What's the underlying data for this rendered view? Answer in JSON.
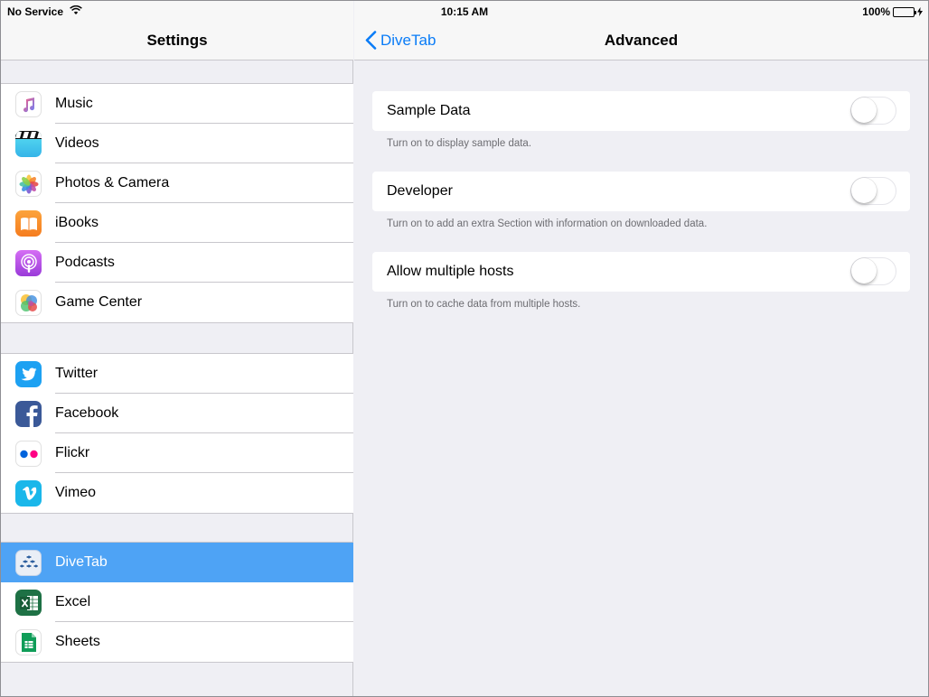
{
  "status": {
    "carrier": "No Service",
    "time": "10:15 AM",
    "battery": "100%",
    "battery_level": 1.0
  },
  "master": {
    "title": "Settings",
    "groups": [
      {
        "items": [
          {
            "label": "Music",
            "icon": "music-icon"
          },
          {
            "label": "Videos",
            "icon": "videos-icon"
          },
          {
            "label": "Photos & Camera",
            "icon": "photos-icon"
          },
          {
            "label": "iBooks",
            "icon": "ibooks-icon"
          },
          {
            "label": "Podcasts",
            "icon": "podcasts-icon"
          },
          {
            "label": "Game Center",
            "icon": "game-center-icon"
          }
        ]
      },
      {
        "items": [
          {
            "label": "Twitter",
            "icon": "twitter-icon"
          },
          {
            "label": "Facebook",
            "icon": "facebook-icon"
          },
          {
            "label": "Flickr",
            "icon": "flickr-icon"
          },
          {
            "label": "Vimeo",
            "icon": "vimeo-icon"
          }
        ]
      },
      {
        "items": [
          {
            "label": "DiveTab",
            "icon": "divetab-icon",
            "selected": true
          },
          {
            "label": "Excel",
            "icon": "excel-icon"
          },
          {
            "label": "Sheets",
            "icon": "sheets-icon"
          }
        ]
      }
    ]
  },
  "detail": {
    "back_label": "DiveTab",
    "title": "Advanced",
    "settings": [
      {
        "label": "Sample Data",
        "footer": "Turn on to display sample data.",
        "on": false
      },
      {
        "label": "Developer",
        "footer": "Turn on to add an extra Section with information on downloaded data.",
        "on": false
      },
      {
        "label": "Allow multiple hosts",
        "footer": "Turn on to cache data from multiple hosts.",
        "on": false
      }
    ]
  },
  "colors": {
    "accent": "#0a7cf7",
    "selected_row": "#4ea3f5",
    "background": "#efeff4"
  }
}
